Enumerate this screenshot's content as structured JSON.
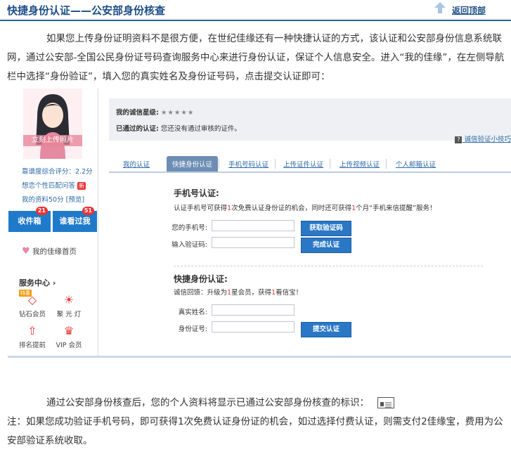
{
  "header": {
    "title": "快捷身份认证——公安部身份核查",
    "back_top": "返回顶部"
  },
  "intro": "如果您上传身份证明资料不是很方便，在世纪佳缘还有一种快捷认证的方式，该认证和公安部身份信息系统联网，通过公安部-全国公民身份证号码查询服务中心来进行身份认证，保证个人信息安全。进入“我的佳缘”，在左侧导航栏中选择“身份验证”，填入您的真实姓名及身份证号码，点击提交认证即可：",
  "sidebar": {
    "upload_photo": "立刻上传照片",
    "score": "靠谱度综合评分：2.2分",
    "q": "想恋个性匹配问答",
    "q_badge": "新",
    "profile": "我的资料50分 [预览]",
    "inbox": "收件箱",
    "inbox_count": "21",
    "visitors": "谁看过我",
    "visitors_count": "51",
    "home": "我的佳缘首页",
    "service_title": "服务中心",
    "services": [
      {
        "label": "钻石会员",
        "icon": "diamond-icon",
        "badge": "特惠"
      },
      {
        "label": "聚 光 灯",
        "icon": "spotlight-icon"
      },
      {
        "label": "排名提前",
        "icon": "rank-up-icon"
      },
      {
        "label": "VIP 会员",
        "icon": "crown-icon"
      }
    ]
  },
  "credit": {
    "star_label": "我的诚信星级:",
    "stars": "★★★★★",
    "verified_label": "已通过的认证:",
    "verified_value": "您还没有通过审核的证件。",
    "tip": "诚信验证小技巧"
  },
  "tabs": [
    "我的认证",
    "快捷身份认证",
    "手机号码认证",
    "上传证件认证",
    "上传视频认证",
    "个人邮箱认证"
  ],
  "phone": {
    "title": "手机号认证:",
    "desc_a": "认证手机号可获得",
    "desc_num1": "1",
    "desc_b": "次免费认证身份证的机会，同时还可获得",
    "desc_num2": "1",
    "desc_c": "个月“手机来信提醒”服务！",
    "phone_label": "您的手机号:",
    "code_label": "输入验证码:",
    "get_code_btn": "获取验证码",
    "finish_btn": "完成认证"
  },
  "idcheck": {
    "title": "快捷身份认证:",
    "desc_a": "诚信回馈：升级为",
    "desc_num1": "1",
    "desc_b": "星会员，获得",
    "desc_num2": "1",
    "desc_c": "看信宝！",
    "name_label": "真实姓名:",
    "id_label": "身份证号:",
    "submit_btn": "提交认证"
  },
  "after": "通过公安部身份核查后，您的个人资料将显示已通过公安部身份核查的标识：",
  "note": "注：如果您成功验证手机号码，即可获得1次免费认证身份证的机会，如过选择付费认证，则需支付2佳缘宝，费用为公安部验证系统收取。"
}
